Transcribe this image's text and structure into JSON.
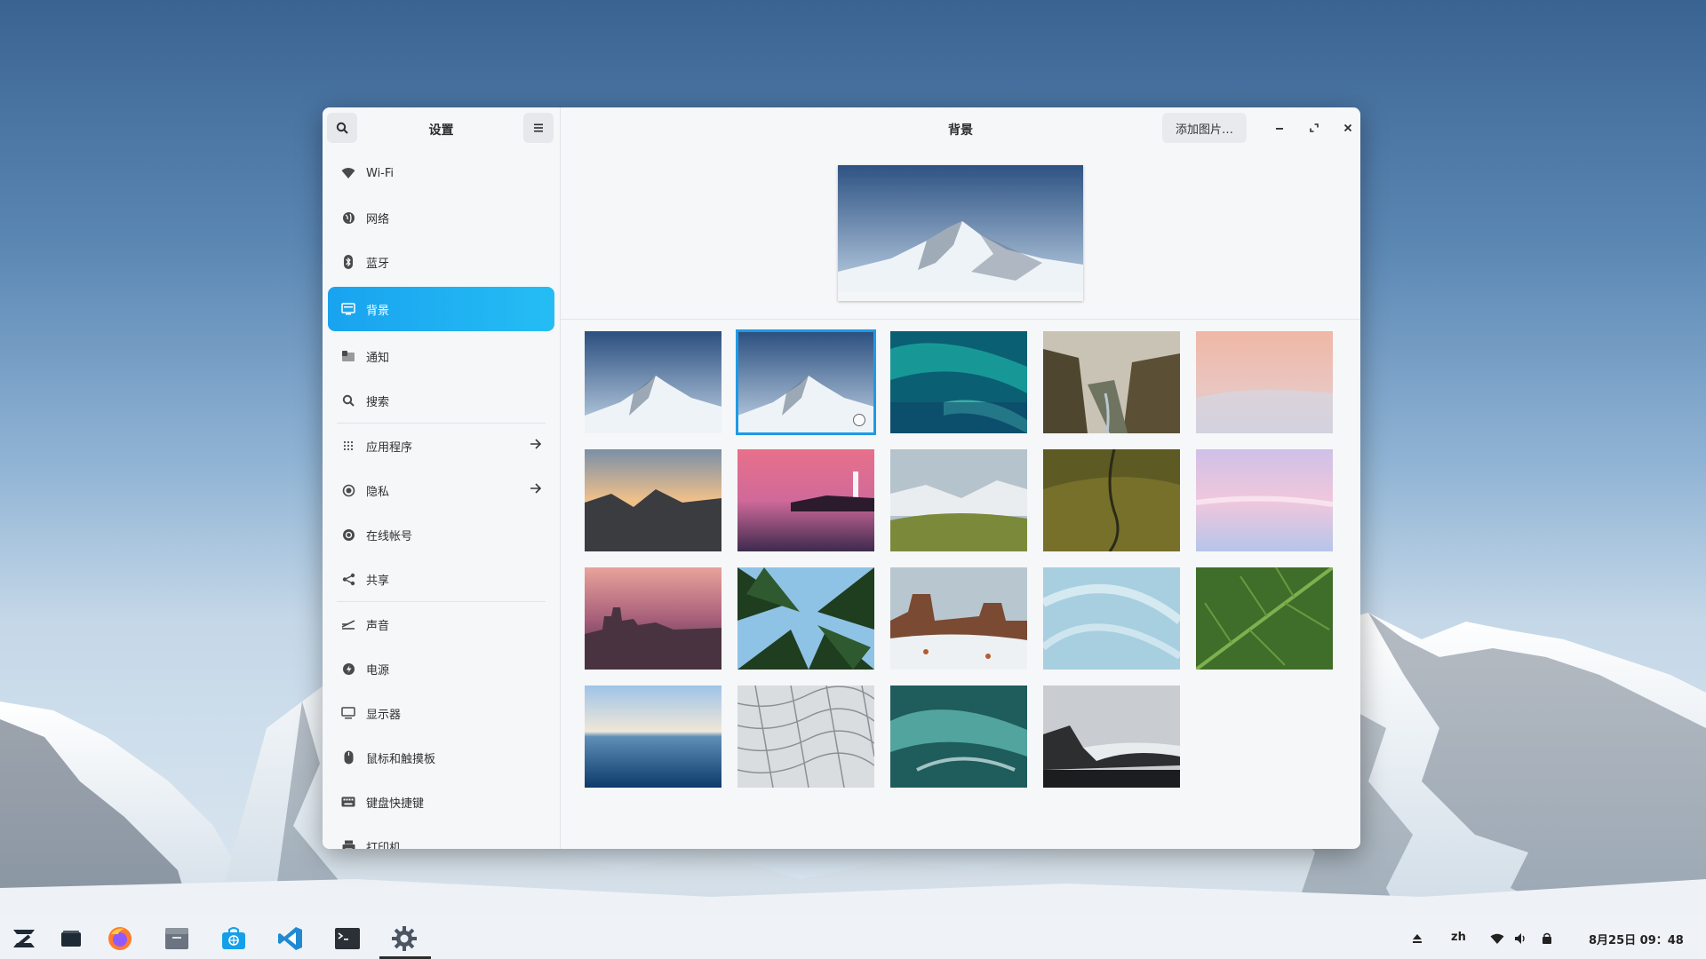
{
  "window": {
    "sidebar_title": "设置",
    "main_title": "背景",
    "add_picture_label": "添加图片…"
  },
  "sidebar": {
    "items": [
      {
        "label": "Wi-Fi",
        "icon": "wifi-icon"
      },
      {
        "label": "网络",
        "icon": "network-icon"
      },
      {
        "label": "蓝牙",
        "icon": "bluetooth-icon"
      },
      {
        "label": "背景",
        "icon": "background-icon",
        "active": true
      },
      {
        "label": "通知",
        "icon": "notifications-icon"
      },
      {
        "label": "搜索",
        "icon": "search-icon"
      },
      {
        "label": "应用程序",
        "icon": "apps-grid-icon",
        "arrow": true
      },
      {
        "label": "隐私",
        "icon": "privacy-icon",
        "arrow": true
      },
      {
        "label": "在线帐号",
        "icon": "online-accounts-icon"
      },
      {
        "label": "共享",
        "icon": "share-icon"
      },
      {
        "label": "声音",
        "icon": "sound-icon"
      },
      {
        "label": "电源",
        "icon": "power-icon"
      },
      {
        "label": "显示器",
        "icon": "display-icon"
      },
      {
        "label": "鼠标和触摸板",
        "icon": "mouse-icon"
      },
      {
        "label": "键盘快捷键",
        "icon": "keyboard-icon"
      },
      {
        "label": "打印机",
        "icon": "printer-icon"
      }
    ]
  },
  "wallpapers": {
    "selected_index": 1,
    "items": [
      "mountain-snow-1",
      "mountain-snow-2",
      "aurora-teal",
      "canyon-river",
      "pink-dunes",
      "sunset-mountains",
      "lighthouse-pink",
      "misty-hills",
      "green-valley-road",
      "pastel-clouds",
      "city-dusk",
      "palm-leaves",
      "desert-snow",
      "abstract-light-blue",
      "green-leaf",
      "ocean-horizon",
      "white-facade",
      "ice-wave",
      "black-beach"
    ]
  },
  "taskbar": {
    "apps": [
      "zorin-menu-icon",
      "files-window-icon",
      "firefox-icon",
      "file-manager-icon",
      "software-store-icon",
      "vscode-icon",
      "terminal-icon",
      "settings-gear-icon"
    ],
    "language": "zh",
    "clock": "8月25日  09：48"
  },
  "colors": {
    "accent": "#1ea6ef",
    "window_bg": "#f6f7f9"
  }
}
